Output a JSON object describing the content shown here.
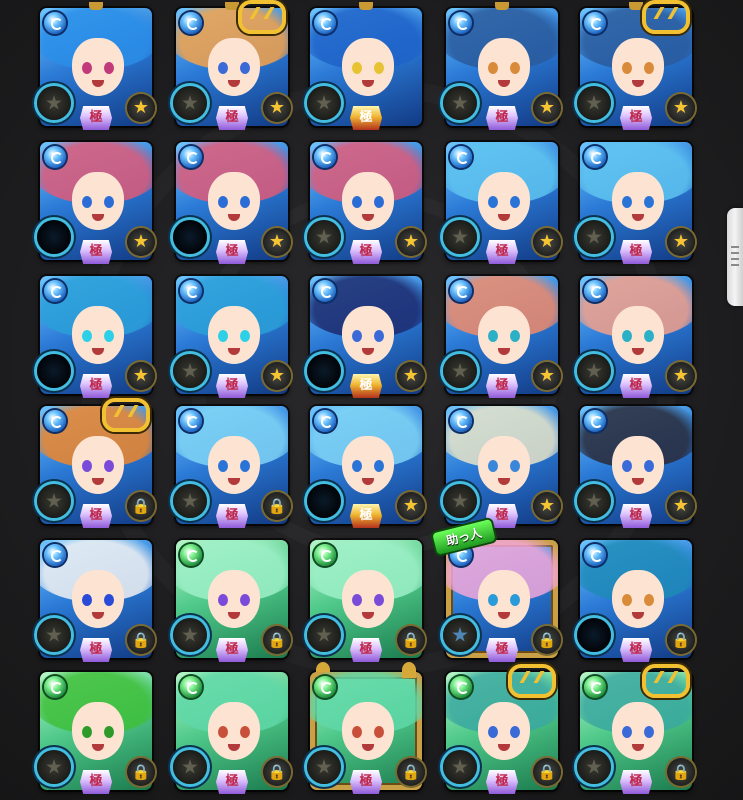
{
  "screen": {
    "title": ""
  },
  "colors": {
    "water": "#2b7ad6",
    "wood": "#4fc98a",
    "gold": "#f1c132",
    "orb_ring": "#43bde0",
    "star": "#f7c531"
  },
  "labels": {
    "kiwami": "極",
    "helper": "助っ人"
  },
  "icons": {
    "star_badge": "star-icon",
    "lock_badge": "lock-icon",
    "infinity": "infinity-icon",
    "element_water": "water-element-icon",
    "element_wood": "wood-element-icon"
  },
  "cards": [
    {
      "element": "water",
      "hair": "#2a8ee8",
      "eyes": "#c23a7a",
      "badge": "star",
      "orb": "plain",
      "kiwami": "purple",
      "infinity": false
    },
    {
      "element": "water",
      "hair": "#f5a34a",
      "eyes": "#3a6ad8",
      "badge": "star",
      "orb": "plain",
      "kiwami": "purple",
      "infinity": true
    },
    {
      "element": "water",
      "hair": "#1e62c8",
      "eyes": "#e7c233",
      "badge": "none",
      "orb": "plain",
      "kiwami": "gold",
      "infinity": false
    },
    {
      "element": "water",
      "hair": "#2a5a9c",
      "eyes": "#d98b3a",
      "badge": "star",
      "orb": "plain",
      "kiwami": "purple",
      "infinity": false
    },
    {
      "element": "water",
      "hair": "#2a5a9c",
      "eyes": "#d98b3a",
      "badge": "star",
      "orb": "plain",
      "kiwami": "purple",
      "infinity": true
    },
    {
      "element": "water",
      "hair": "#e05a78",
      "eyes": "#2b6cd6",
      "badge": "star",
      "orb": "dark",
      "kiwami": "purple",
      "infinity": false
    },
    {
      "element": "water",
      "hair": "#e05a78",
      "eyes": "#2b6cd6",
      "badge": "star",
      "orb": "dark",
      "kiwami": "purple",
      "infinity": false
    },
    {
      "element": "water",
      "hair": "#e05a78",
      "eyes": "#2b6cd6",
      "badge": "star",
      "orb": "plain",
      "kiwami": "purple",
      "infinity": false
    },
    {
      "element": "water",
      "hair": "#5fc5f0",
      "eyes": "#2a74d8",
      "badge": "star",
      "orb": "plain",
      "kiwami": "purple",
      "infinity": false
    },
    {
      "element": "water",
      "hair": "#5fc5f0",
      "eyes": "#2a74d8",
      "badge": "star",
      "orb": "plain",
      "kiwami": "purple",
      "infinity": false
    },
    {
      "element": "water",
      "hair": "#2aa0d8",
      "eyes": "#2ed0e8",
      "badge": "star",
      "orb": "dark",
      "kiwami": "purple",
      "infinity": false
    },
    {
      "element": "water",
      "hair": "#2aa0d8",
      "eyes": "#2ed0e8",
      "badge": "star",
      "orb": "plain",
      "kiwami": "purple",
      "infinity": false
    },
    {
      "element": "water",
      "hair": "#1d2a6e",
      "eyes": "#3a6ad8",
      "badge": "star",
      "orb": "dark",
      "kiwami": "gold",
      "infinity": false
    },
    {
      "element": "water",
      "hair": "#f08a6a",
      "eyes": "#2bb0c8",
      "badge": "star",
      "orb": "plain",
      "kiwami": "purple",
      "infinity": false
    },
    {
      "element": "water",
      "hair": "#f4a08a",
      "eyes": "#2bb0c8",
      "badge": "star",
      "orb": "plain",
      "kiwami": "purple",
      "infinity": false
    },
    {
      "element": "water",
      "hair": "#f0862a",
      "eyes": "#7a4ad8",
      "badge": "lock",
      "orb": "plain",
      "kiwami": "purple",
      "infinity": true
    },
    {
      "element": "water",
      "hair": "#7fd4f5",
      "eyes": "#2a74d8",
      "badge": "lock",
      "orb": "plain",
      "kiwami": "purple",
      "infinity": false
    },
    {
      "element": "water",
      "hair": "#7fd4f5",
      "eyes": "#2a74d8",
      "badge": "star",
      "orb": "dark",
      "kiwami": "gold",
      "infinity": false
    },
    {
      "element": "water",
      "hair": "#e8e4c8",
      "eyes": "#3a86d8",
      "badge": "star",
      "orb": "plain",
      "kiwami": "purple",
      "infinity": false
    },
    {
      "element": "water",
      "hair": "#2a2a38",
      "eyes": "#3a6ad8",
      "badge": "star",
      "orb": "plain",
      "kiwami": "purple",
      "infinity": false
    },
    {
      "element": "water",
      "hair": "#f2f2f2",
      "eyes": "#2a4ad8",
      "badge": "lock",
      "orb": "plain",
      "kiwami": "purple",
      "infinity": false
    },
    {
      "element": "wood",
      "hair": "#9ef0c8",
      "eyes": "#7a4ad8",
      "badge": "lock",
      "orb": "plain",
      "kiwami": "purple",
      "infinity": false
    },
    {
      "element": "wood",
      "hair": "#9ef0c8",
      "eyes": "#7a4ad8",
      "badge": "lock",
      "orb": "plain",
      "kiwami": "purple",
      "infinity": false
    },
    {
      "element": "water",
      "hair": "#f3a6d8",
      "eyes": "#2a9ad8",
      "badge": "lock",
      "orb": "blue",
      "kiwami": "purple",
      "infinity": false,
      "helper": true
    },
    {
      "element": "water",
      "hair": "#1e8ab8",
      "eyes": "#d98b3a",
      "badge": "lock",
      "orb": "dark",
      "kiwami": "purple",
      "infinity": false
    },
    {
      "element": "wood",
      "hair": "#3fbf3a",
      "eyes": "#2e9a2a",
      "badge": "lock",
      "orb": "plain",
      "kiwami": "purple",
      "infinity": false
    },
    {
      "element": "wood",
      "hair": "#5fd8a8",
      "eyes": "#c8503a",
      "badge": "lock",
      "orb": "plain",
      "kiwami": "purple",
      "infinity": false
    },
    {
      "element": "wood",
      "hair": "#5fd8a8",
      "eyes": "#c8503a",
      "badge": "lock",
      "orb": "plain",
      "kiwami": "purple",
      "infinity": false,
      "gold_frame": true
    },
    {
      "element": "wood",
      "hair": "#3aa8a0",
      "eyes": "#3a6ad8",
      "badge": "lock",
      "orb": "plain",
      "kiwami": "purple",
      "infinity": true
    },
    {
      "element": "wood",
      "hair": "#3aa8a0",
      "eyes": "#3a6ad8",
      "badge": "lock",
      "orb": "plain",
      "kiwami": "purple",
      "infinity": true
    }
  ]
}
